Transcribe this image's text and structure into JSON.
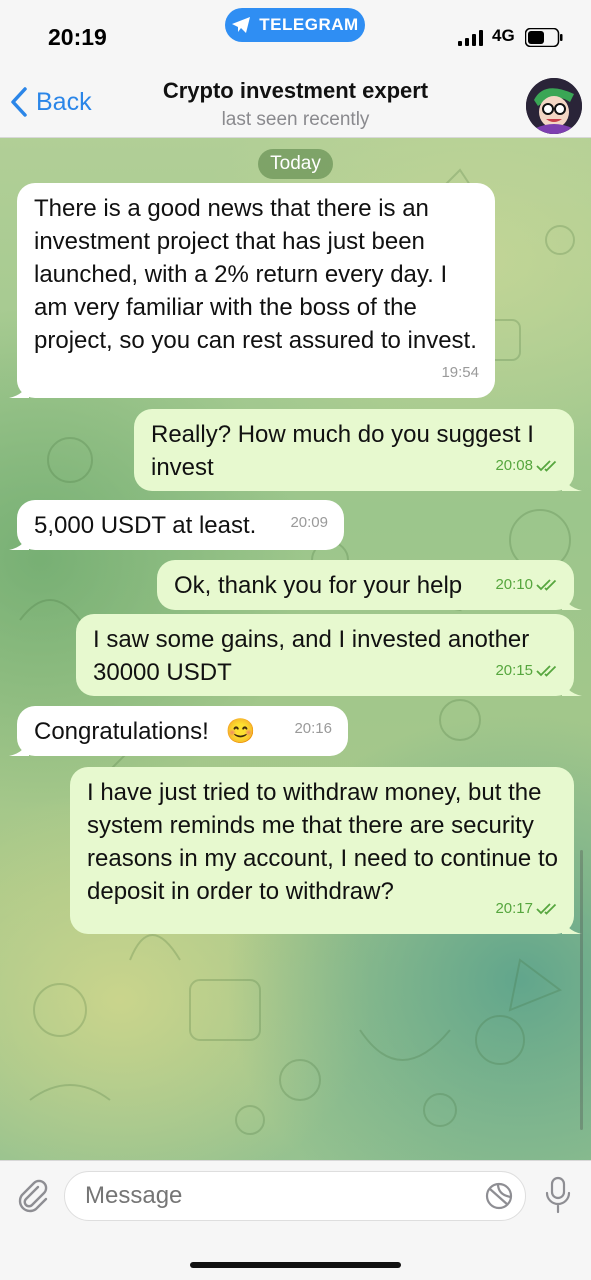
{
  "status_bar": {
    "time": "20:19",
    "network": "4G",
    "telegram_label": "TELEGRAM"
  },
  "header": {
    "back_label": "Back",
    "title": "Crypto investment expert",
    "subtitle": "last seen recently"
  },
  "date_divider": "Today",
  "messages": [
    {
      "direction": "in",
      "text": "There is a good news that there is an investment project that has just been launched, with a 2% return every day. I am very familiar with the boss of the project, so you can rest assured to invest.",
      "time": "19:54"
    },
    {
      "direction": "out",
      "text": "Really? How much do you suggest I invest",
      "time": "20:08"
    },
    {
      "direction": "in",
      "text": "5,000 USDT at least.",
      "time": "20:09"
    },
    {
      "direction": "out",
      "text": "Ok, thank you for your help",
      "time": "20:10"
    },
    {
      "direction": "out",
      "text": "I saw some gains, and I invested another 30000 USDT",
      "time": "20:15"
    },
    {
      "direction": "in",
      "text": "Congratulations! ",
      "emoji": "😊",
      "time": "20:16"
    },
    {
      "direction": "out",
      "text": "I have just tried to withdraw money, but the system reminds me that there are security reasons in my account, I need to continue to deposit in order to withdraw?",
      "time": "20:17"
    }
  ],
  "input": {
    "placeholder": "Message"
  },
  "icons": {
    "telegram": "paper-plane-icon",
    "back": "chevron-left-icon",
    "attach": "paperclip-icon",
    "sticker": "sticker-icon",
    "mic": "microphone-icon",
    "read": "double-check-icon"
  },
  "colors": {
    "accent": "#2b86e8",
    "outgoing_bubble": "#e7f9cf",
    "incoming_bubble": "#ffffff",
    "read_check": "#56a63e"
  }
}
